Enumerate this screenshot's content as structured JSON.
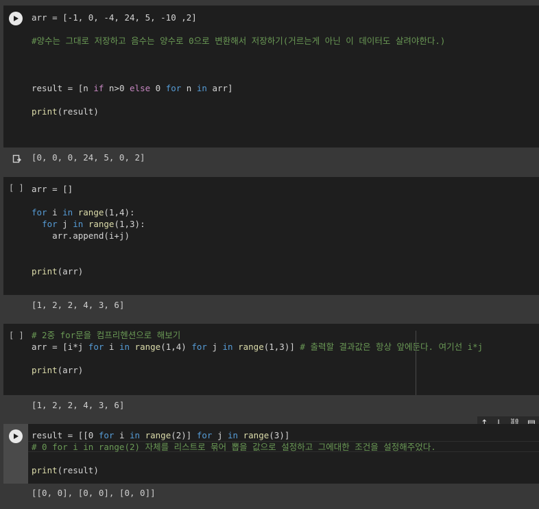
{
  "cells": [
    {
      "id": "c1",
      "run_state": "run",
      "lines": [
        "arr = [-1, 0, -4, 24, 5, -10 ,2]",
        "",
        "#양수는 그대로 저장하고 음수는 양수로 0으로 변환해서 저장하기(거르는게 아닌 이 데이터도 살려야한다.)",
        "",
        "",
        "",
        "result = [n if n>0 else 0 for n in arr]",
        "",
        "print(result)"
      ],
      "output": "[0, 0, 0, 24, 5, 0, 2]"
    },
    {
      "id": "c2",
      "run_state": "[ ]",
      "lines": [
        "arr = []",
        "",
        "for i in range(1,4):",
        "  for j in range(1,3):",
        "    arr.append(i+j)",
        "",
        "",
        "print(arr)"
      ],
      "output": "[1, 2, 2, 4, 3, 6]"
    },
    {
      "id": "c3",
      "run_state": "[ ]",
      "lines": [
        "# 2중 for문을 컴프리헨션으로 해보기",
        "arr = [i*j for i in range(1,4) for j in range(1,3)] # 출력할 결과값은 항상 앞에둔다. 여기선 i*j",
        "",
        "print(arr)"
      ],
      "output": "[1, 2, 2, 4, 3, 6]"
    },
    {
      "id": "c4",
      "run_state": "run",
      "lines": [
        "result = [[0 for i in range(2)] for j in range(3)]",
        "# 0 for i in range(2) 자체를 리스트로 묶어 뽑을 값으로 설정하고 그에대한 조건을 설정해주었다.",
        "",
        "print(result)"
      ],
      "output": "[[0, 0], [0, 0], [0, 0]]"
    }
  ],
  "toolbar": {
    "up_icon": "↑",
    "down_icon": "↓",
    "link_icon": "⛓",
    "comment_icon": "▤"
  }
}
